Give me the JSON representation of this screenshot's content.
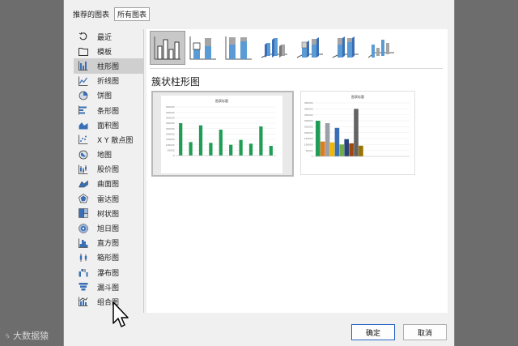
{
  "tabs": [
    {
      "label": "推荐的图表"
    },
    {
      "label": "所有图表"
    }
  ],
  "sidebar": {
    "items": [
      {
        "label": "最近",
        "icon": "recent-icon"
      },
      {
        "label": "模板",
        "icon": "template-folder-icon"
      },
      {
        "label": "柱形图",
        "icon": "column-chart-icon",
        "selected": true
      },
      {
        "label": "折线图",
        "icon": "line-chart-icon"
      },
      {
        "label": "饼图",
        "icon": "pie-chart-icon"
      },
      {
        "label": "条形图",
        "icon": "bar-chart-icon"
      },
      {
        "label": "面积图",
        "icon": "area-chart-icon"
      },
      {
        "label": "X Y 散点图",
        "icon": "scatter-chart-icon"
      },
      {
        "label": "地图",
        "icon": "map-chart-icon"
      },
      {
        "label": "股价图",
        "icon": "stock-chart-icon"
      },
      {
        "label": "曲面图",
        "icon": "surface-chart-icon"
      },
      {
        "label": "雷达图",
        "icon": "radar-chart-icon"
      },
      {
        "label": "树状图",
        "icon": "treemap-chart-icon"
      },
      {
        "label": "旭日图",
        "icon": "sunburst-chart-icon"
      },
      {
        "label": "直方图",
        "icon": "histogram-chart-icon"
      },
      {
        "label": "箱形图",
        "icon": "box-whisker-chart-icon"
      },
      {
        "label": "瀑布图",
        "icon": "waterfall-chart-icon"
      },
      {
        "label": "漏斗图",
        "icon": "funnel-chart-icon"
      },
      {
        "label": "组合图",
        "icon": "combo-chart-icon"
      }
    ]
  },
  "main": {
    "section_title": "簇状柱形图",
    "subtypes": [
      {
        "icon": "clustered-column-icon",
        "selected": true
      },
      {
        "icon": "stacked-column-icon"
      },
      {
        "icon": "100-stacked-column-icon"
      },
      {
        "icon": "3d-clustered-column-icon"
      },
      {
        "icon": "3d-stacked-column-icon"
      },
      {
        "icon": "3d-100-stacked-column-icon"
      },
      {
        "icon": "3d-column-icon"
      }
    ],
    "preview_title": "图表标题"
  },
  "chart_data": [
    {
      "type": "bar",
      "title": "图表标题",
      "ylim": [
        0,
        450000
      ],
      "y_ticks": [
        "450000",
        "400000",
        "350000",
        "300000",
        "250000",
        "200000",
        "150000",
        "100000",
        "50000",
        "0"
      ],
      "series": [
        {
          "values": [
            300000,
            125000,
            280000,
            118000,
            240000,
            100000,
            145000,
            110000,
            270000,
            90000
          ],
          "color": "#1f9d55"
        }
      ]
    },
    {
      "type": "bar",
      "title": "图表标题",
      "ylim": [
        0,
        450000
      ],
      "y_ticks": [
        "450000",
        "400000",
        "350000",
        "300000",
        "250000",
        "200000",
        "150000",
        "100000",
        "50000",
        "0"
      ],
      "series": [
        {
          "values": [
            300000
          ],
          "color": "#1f9d55"
        },
        {
          "values": [
            125000
          ],
          "color": "#e07b1f"
        },
        {
          "values": [
            280000
          ],
          "color": "#9aa0a6"
        },
        {
          "values": [
            118000
          ],
          "color": "#f2b700"
        },
        {
          "values": [
            240000
          ],
          "color": "#3a6fb5"
        },
        {
          "values": [
            100000
          ],
          "color": "#70ad47"
        },
        {
          "values": [
            145000
          ],
          "color": "#264478"
        },
        {
          "values": [
            110000
          ],
          "color": "#9e480e"
        },
        {
          "values": [
            400000
          ],
          "color": "#636363"
        },
        {
          "values": [
            90000
          ],
          "color": "#997300"
        }
      ]
    }
  ],
  "footer": {
    "ok_label": "确定",
    "cancel_label": "取消"
  },
  "watermark": "大数据猿",
  "colors": {
    "accent": "#2b66c4",
    "icon_blue": "#3a6fb5",
    "selection": "#c8c8c8"
  }
}
